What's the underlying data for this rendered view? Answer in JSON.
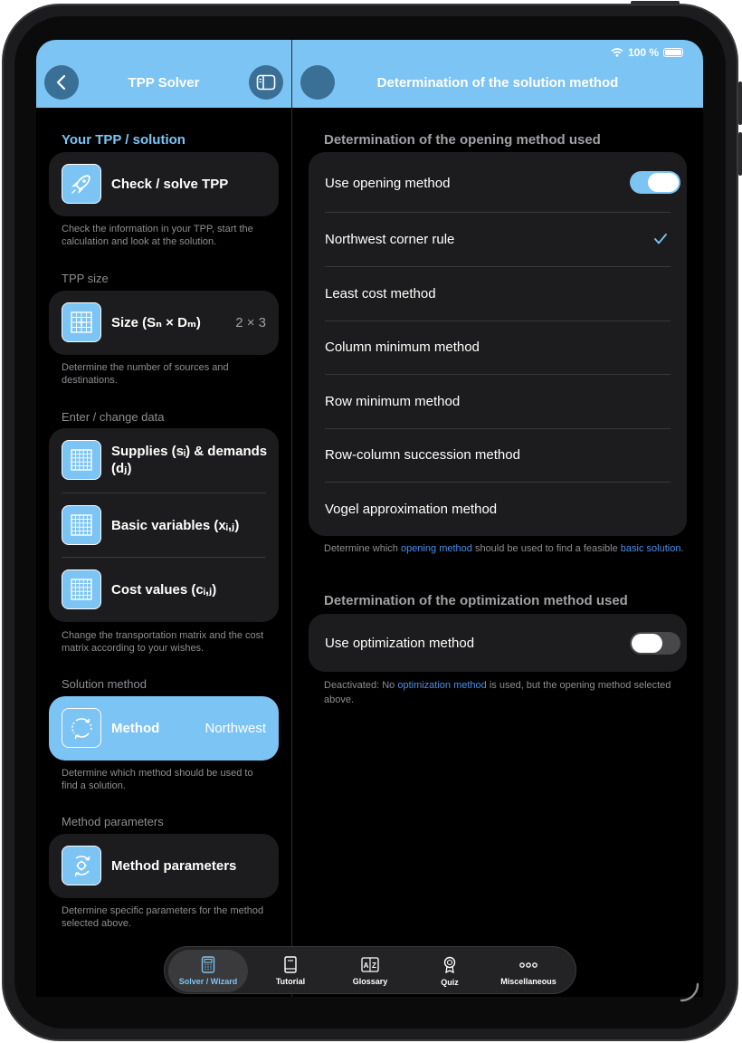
{
  "status": {
    "battery_text": "100 %"
  },
  "left_header": {
    "title": "TPP Solver"
  },
  "right_header": {
    "title": "Determination of the solution method"
  },
  "sidebar": {
    "section_solution": "Your TPP / solution",
    "check_solve": "Check / solve TPP",
    "check_hint": "Check the information in your TPP, start the calculation and look at the solution.",
    "section_size": "TPP size",
    "size_label": "Size (Sₙ × Dₘ)",
    "size_value": "2 × 3",
    "size_hint": "Determine the number of sources and destinations.",
    "section_data": "Enter / change data",
    "supplies": "Supplies (sᵢ) & demands (dⱼ)",
    "basic_vars": "Basic variables (xᵢ,ⱼ)",
    "cost_values": "Cost values (cᵢ,ⱼ)",
    "data_hint": "Change the transportation matrix and the cost matrix according to your wishes.",
    "section_method": "Solution method",
    "method_label": "Method",
    "method_value": "Northwest",
    "method_hint": "Determine which method should be used to find a solution.",
    "section_params": "Method parameters",
    "params_label": "Method parameters",
    "params_hint": "Determine specific parameters for the method selected above."
  },
  "opening": {
    "section_title": "Determination of the opening method used",
    "use_label": "Use opening method",
    "use_enabled": true,
    "methods": [
      "Northwest corner rule",
      "Least cost method",
      "Column minimum method",
      "Row minimum method",
      "Row-column succession method",
      "Vogel approximation method"
    ],
    "selected_index": 0,
    "hint_pre": "Determine which ",
    "hint_link1": "opening method",
    "hint_mid": " should be used to find a feasible ",
    "hint_link2": "basic solution",
    "hint_post": "."
  },
  "optimization": {
    "section_title": "Determination of the optimization method used",
    "use_label": "Use optimization method",
    "use_enabled": false,
    "hint_pre": "Deactivated: No ",
    "hint_link": "optimization method",
    "hint_post": " is used, but the opening method selected above."
  },
  "tabbar": {
    "tabs": [
      {
        "label": "Solver / Wizard",
        "icon": "calculator-icon",
        "active": true
      },
      {
        "label": "Tutorial",
        "icon": "book-icon",
        "active": false
      },
      {
        "label": "Glossary",
        "icon": "a-z-icon",
        "active": false
      },
      {
        "label": "Quiz",
        "icon": "award-icon",
        "active": false
      },
      {
        "label": "Miscellaneous",
        "icon": "ellipsis-icon",
        "active": false
      }
    ]
  },
  "colors": {
    "accent": "#7cc4f4",
    "link": "#4a8fe8",
    "card": "#1c1c1e"
  }
}
